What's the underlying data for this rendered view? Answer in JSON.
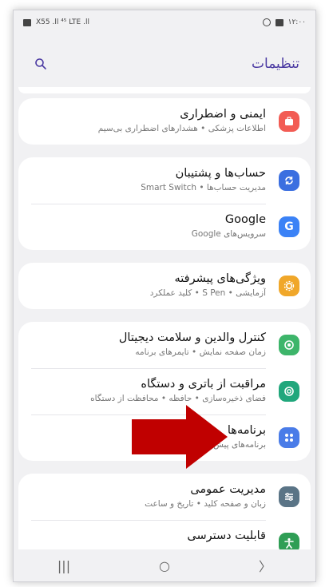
{
  "status_bar": {
    "time": "۱۲:۰۰",
    "left_text": "X55 .ll ⁴⁵ LTE .ll"
  },
  "header": {
    "title": "تنظیمات"
  },
  "settings": [
    {
      "title": "ایمنی و اضطراری",
      "subtitle": "اطلاعات پزشکی • هشدارهای اضطراری بی‌سیم",
      "icon": "emergency-icon",
      "color": "#f25c54"
    },
    {
      "title": "حساب‌ها و پشتیبان",
      "subtitle": "مدیریت حساب‌ها • Smart Switch",
      "icon": "sync-icon",
      "color": "#3b6fe0"
    },
    {
      "title": "Google",
      "subtitle": "سرویس‌های Google",
      "icon": "google-icon",
      "color": "#3b82f6"
    },
    {
      "title": "ویژگی‌های پیشرفته",
      "subtitle": "آزمایشی • S Pen • کلید عملکرد",
      "icon": "advanced-features-icon",
      "color": "#f0a72a"
    },
    {
      "title": "کنترل والدین و سلامت دیجیتال",
      "subtitle": "زمان صفحه نمایش • تایمرهای برنامه",
      "icon": "digital-wellbeing-icon",
      "color": "#3db56a"
    },
    {
      "title": "مراقبت از باتری و دستگاه",
      "subtitle": "فضای ذخیره‌سازی • حافظه • محافظت از دستگاه",
      "icon": "device-care-icon",
      "color": "#21a77c"
    },
    {
      "title": "برنامه‌ها",
      "subtitle": "برنامه‌های پیش‌فرض • تنظیمات برنامه",
      "icon": "apps-icon",
      "color": "#4a7ce8"
    },
    {
      "title": "مدیریت عمومی",
      "subtitle": "زبان و صفحه کلید • تاریخ و ساعت",
      "icon": "general-management-icon",
      "color": "#5a7486"
    },
    {
      "title": "قابلیت دسترسی",
      "subtitle": "",
      "icon": "accessibility-icon",
      "color": "#2f9e55"
    }
  ],
  "navbar": {
    "recents": "|||",
    "home": "○",
    "back": "〉"
  },
  "annotation": {
    "arrow_color": "#c00000"
  }
}
